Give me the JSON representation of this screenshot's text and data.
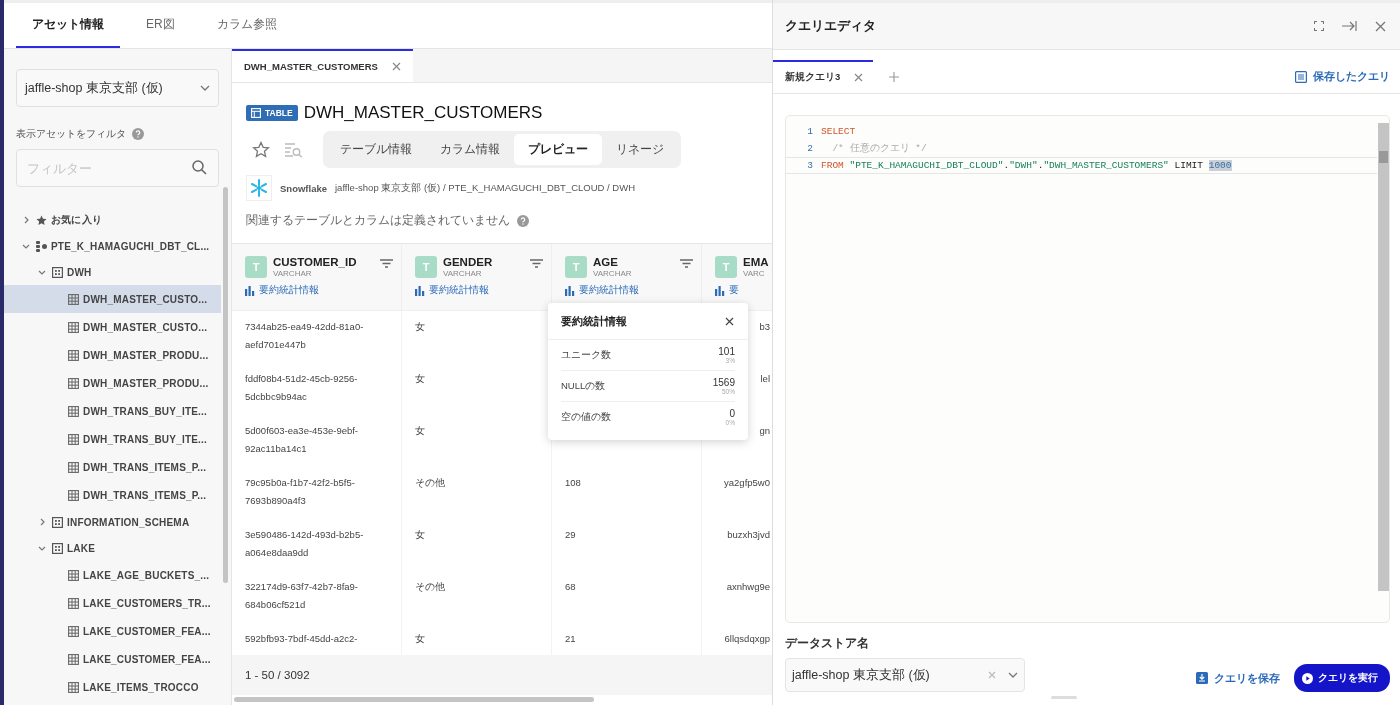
{
  "left_tabs": [
    {
      "label": "アセット情報",
      "selected": true
    },
    {
      "label": "ER図",
      "selected": false
    },
    {
      "label": "カラム参照",
      "selected": false
    }
  ],
  "sidebar": {
    "datastore_select": {
      "value": "jaffle-shop 東京支部 (仮)"
    },
    "filter_label": "表示アセットをフィルタ",
    "filter": {
      "placeholder": "フィルター"
    },
    "tree": [
      {
        "label": "お気に入り",
        "kind": "favorites",
        "expanded": false
      },
      {
        "label": "PTE_K_HAMAGUCHI_DBT_CL...",
        "kind": "database",
        "expanded": true,
        "children": [
          {
            "label": "DWH",
            "kind": "schema",
            "expanded": true,
            "children": [
              {
                "label": "DWH_MASTER_CUSTO...",
                "kind": "table",
                "selected": true
              },
              {
                "label": "DWH_MASTER_CUSTO...",
                "kind": "table",
                "selected": false
              },
              {
                "label": "DWH_MASTER_PRODU...",
                "kind": "table",
                "selected": false
              },
              {
                "label": "DWH_MASTER_PRODU...",
                "kind": "table",
                "selected": false
              },
              {
                "label": "DWH_TRANS_BUY_ITE...",
                "kind": "table",
                "selected": false
              },
              {
                "label": "DWH_TRANS_BUY_ITE...",
                "kind": "table",
                "selected": false
              },
              {
                "label": "DWH_TRANS_ITEMS_P...",
                "kind": "table",
                "selected": false
              },
              {
                "label": "DWH_TRANS_ITEMS_P...",
                "kind": "table",
                "selected": false
              }
            ]
          },
          {
            "label": "INFORMATION_SCHEMA",
            "kind": "schema",
            "expanded": false
          },
          {
            "label": "LAKE",
            "kind": "schema",
            "expanded": true,
            "children": [
              {
                "label": "LAKE_AGE_BUCKETS_...",
                "kind": "table",
                "selected": false
              },
              {
                "label": "LAKE_CUSTOMERS_TR...",
                "kind": "table",
                "selected": false
              },
              {
                "label": "LAKE_CUSTOMER_FEA...",
                "kind": "table",
                "selected": false
              },
              {
                "label": "LAKE_CUSTOMER_FEA...",
                "kind": "table",
                "selected": false
              },
              {
                "label": "LAKE_ITEMS_TROCCO",
                "kind": "table",
                "selected": false
              }
            ]
          }
        ]
      }
    ]
  },
  "asset": {
    "doc_tab": {
      "label": "DWH_MASTER_CUSTOMERS"
    },
    "type_badge": "TABLE",
    "title": "DWH_MASTER_CUSTOMERS",
    "starred": false,
    "view_tabs": [
      {
        "label": "テーブル情報",
        "selected": false
      },
      {
        "label": "カラム情報",
        "selected": false
      },
      {
        "label": "プレビュー",
        "selected": true
      },
      {
        "label": "リネージ",
        "selected": false
      }
    ],
    "source": "Snowflake",
    "path": "jaffle-shop 東京支部 (仮) / PTE_K_HAMAGUCHI_DBT_CLOUD / DWH",
    "relation_note": "関連するテーブルとカラムは定義されていません",
    "table": {
      "columns": [
        {
          "type_letter": "T",
          "name": "CUSTOMER_ID",
          "type": "VARCHAR",
          "stats_link": "要約統計情報",
          "filterable": true
        },
        {
          "type_letter": "T",
          "name": "GENDER",
          "type": "VARCHAR",
          "stats_link": "要約統計情報",
          "filterable": true
        },
        {
          "type_letter": "T",
          "name": "AGE",
          "type": "VARCHAR",
          "stats_link": "要約統計情報",
          "filterable": true
        },
        {
          "type_letter": "T",
          "name": "EMA",
          "type": "VARC",
          "stats_link": "要",
          "filterable": false
        }
      ],
      "rows": [
        [
          "7344ab25-ea49-42dd-81a0-aefd701e447b",
          "女",
          null,
          "b3"
        ],
        [
          "fddf08b4-51d2-45cb-9256-5dcbbc9b94ac",
          "女",
          null,
          "lel"
        ],
        [
          "5d00f603-ea3e-453e-9ebf-92ac11ba14c1",
          "女",
          null,
          "gn"
        ],
        [
          "79c95b0a-f1b7-42f2-b5f5-7693b890a4f3",
          "その他",
          "108",
          "ya2gfp5w0"
        ],
        [
          "3e590486-142d-493d-b2b5-a064e8daa9dd",
          "女",
          "29",
          "buzxh3jvd"
        ],
        [
          "322174d9-63f7-42b7-8fa9-684b06cf521d",
          "その他",
          "68",
          "axnhwg9e"
        ],
        [
          "592bfb93-7bdf-45dd-a2c2-",
          "女",
          "21",
          "6llqsdqxgp"
        ]
      ],
      "footer": "1 - 50 / 3092"
    },
    "stats_popover": {
      "title": "要約統計情報",
      "rows": [
        {
          "label": "ユニーク数",
          "value": "101",
          "percent": "3%"
        },
        {
          "label": "NULLの数",
          "value": "1569",
          "percent": "50%"
        },
        {
          "label": "空の値の数",
          "value": "0",
          "percent": "0%"
        }
      ]
    }
  },
  "query_editor": {
    "title": "クエリエディタ",
    "tabs": [
      {
        "label": "新規クエリ3",
        "selected": true
      }
    ],
    "saved_queries_link": "保存したクエリ",
    "lines": [
      {
        "number": "1",
        "current": false,
        "tokens": [
          {
            "text": "SELECT",
            "kind": "keyword"
          }
        ]
      },
      {
        "number": "2",
        "current": false,
        "tokens": [
          {
            "text": "  /* 任意のクエリ */",
            "kind": "comment"
          }
        ]
      },
      {
        "number": "3",
        "current": true,
        "tokens": [
          {
            "text": "FROM",
            "kind": "keyword"
          },
          {
            "text": " \"PTE_K_HAMAGUCHI_DBT_CLOUD\"",
            "kind": "string"
          },
          {
            "text": ".",
            "kind": "plain"
          },
          {
            "text": "\"DWH\"",
            "kind": "string"
          },
          {
            "text": ".",
            "kind": "plain"
          },
          {
            "text": "\"DWH_MASTER_CUSTOMERS\"",
            "kind": "string"
          },
          {
            "text": " LIMIT ",
            "kind": "plain"
          },
          {
            "text": "1000",
            "kind": "selection"
          }
        ]
      }
    ],
    "datastore_label": "データストア名",
    "datastore_select": {
      "value": "jaffle-shop 東京支部 (仮)"
    },
    "save_button": "クエリを保存",
    "run_button": "クエリを実行"
  }
}
